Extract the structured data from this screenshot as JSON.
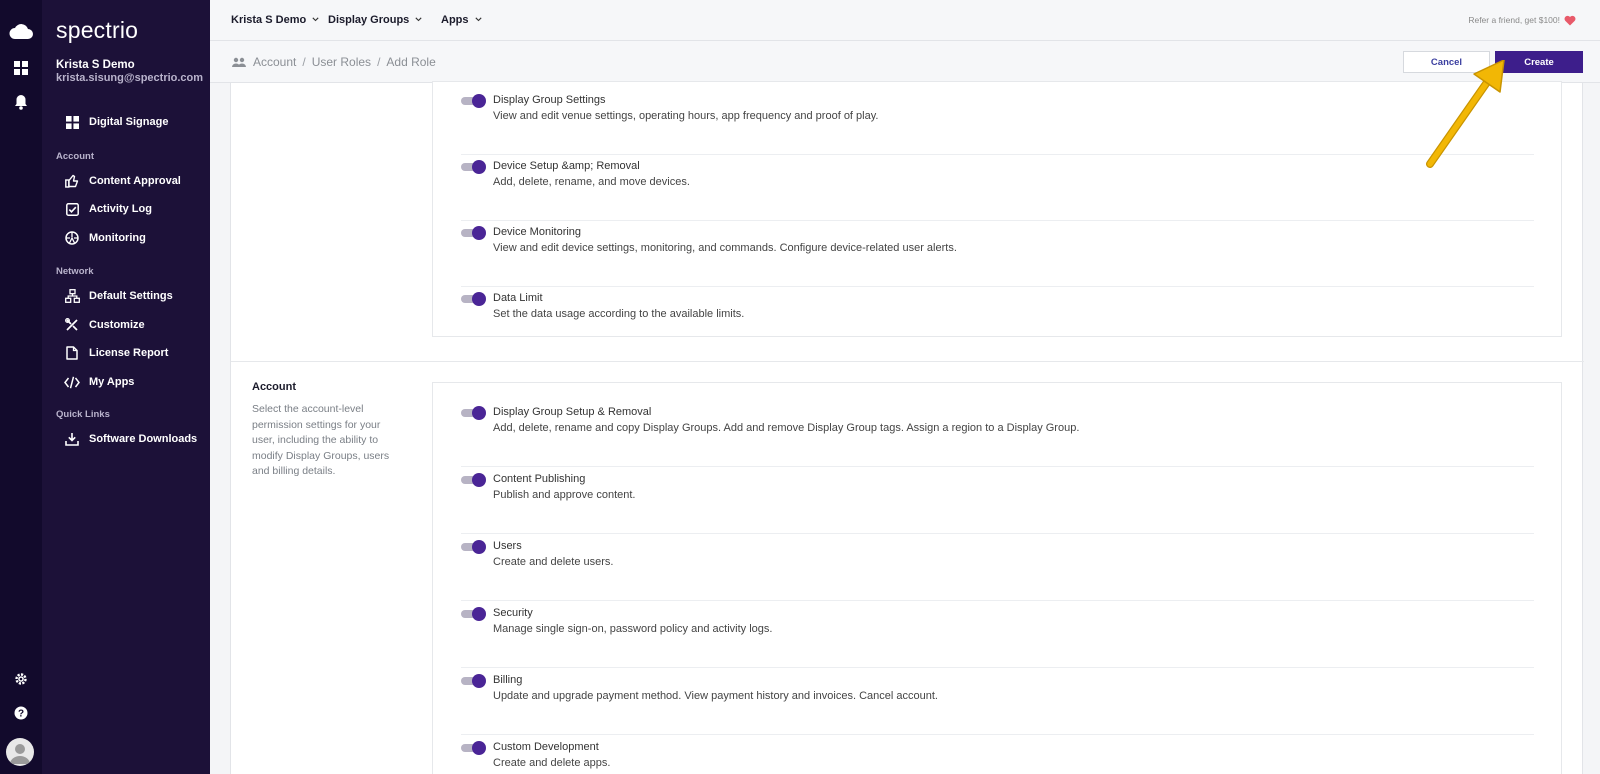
{
  "brand": {
    "logo": "spectrio"
  },
  "user": {
    "name": "Krista S Demo",
    "email": "krista.sisung@spectrio.com"
  },
  "sidebar": {
    "main_item": {
      "label": "Digital Signage",
      "icon": "dashboard-icon"
    },
    "sections": [
      {
        "title": "Account",
        "items": [
          {
            "label": "Content Approval",
            "icon": "thumbs-up-icon"
          },
          {
            "label": "Activity Log",
            "icon": "checkbox-icon"
          },
          {
            "label": "Monitoring",
            "icon": "monitoring-icon"
          }
        ]
      },
      {
        "title": "Network",
        "items": [
          {
            "label": "Default Settings",
            "icon": "network-icon"
          },
          {
            "label": "Customize",
            "icon": "tools-icon"
          },
          {
            "label": "License Report",
            "icon": "document-icon"
          },
          {
            "label": "My Apps",
            "icon": "code-icon"
          }
        ]
      },
      {
        "title": "Quick Links",
        "items": [
          {
            "label": "Software Downloads",
            "icon": "download-icon"
          }
        ]
      }
    ]
  },
  "topbar": {
    "nav": [
      {
        "label": "Krista S Demo"
      },
      {
        "label": "Display Groups"
      },
      {
        "label": "Apps"
      }
    ],
    "refer": "Refer a friend, get $100!"
  },
  "breadcrumb": {
    "items": [
      "Account",
      "User Roles",
      "Add Role"
    ],
    "separator": "/"
  },
  "actions": {
    "cancel": "Cancel",
    "create": "Create"
  },
  "colors": {
    "primary": "#3d1e8b",
    "sidebar": "#1c1138",
    "rail": "#120a2c",
    "arrow": "#f2b705"
  },
  "permissions_top": [
    {
      "title": "Display Group Settings",
      "desc": "View and edit venue settings, operating hours, app frequency and proof of play.",
      "enabled": true
    },
    {
      "title": "Device Setup &amp; Removal",
      "desc": "Add, delete, rename, and move devices.",
      "enabled": true
    },
    {
      "title": "Device Monitoring",
      "desc": "View and edit device settings, monitoring, and commands. Configure device-related user alerts.",
      "enabled": true
    },
    {
      "title": "Data Limit",
      "desc": "Set the data usage according to the available limits.",
      "enabled": true
    }
  ],
  "account_section": {
    "title": "Account",
    "description": "Select the account-level permission settings for your user, including the ability to modify Display Groups, users and billing details.",
    "permissions": [
      {
        "title": "Display Group Setup & Removal",
        "desc": "Add, delete, rename and copy Display Groups. Add and remove Display Group tags. Assign a region to a Display Group.",
        "enabled": true
      },
      {
        "title": "Content Publishing",
        "desc": "Publish and approve content.",
        "enabled": true
      },
      {
        "title": "Users",
        "desc": "Create and delete users.",
        "enabled": true
      },
      {
        "title": "Security",
        "desc": "Manage single sign-on, password policy and activity logs.",
        "enabled": true
      },
      {
        "title": "Billing",
        "desc": "Update and upgrade payment method. View payment history and invoices. Cancel account.",
        "enabled": true
      },
      {
        "title": "Custom Development",
        "desc": "Create and delete apps.",
        "enabled": true
      }
    ]
  }
}
